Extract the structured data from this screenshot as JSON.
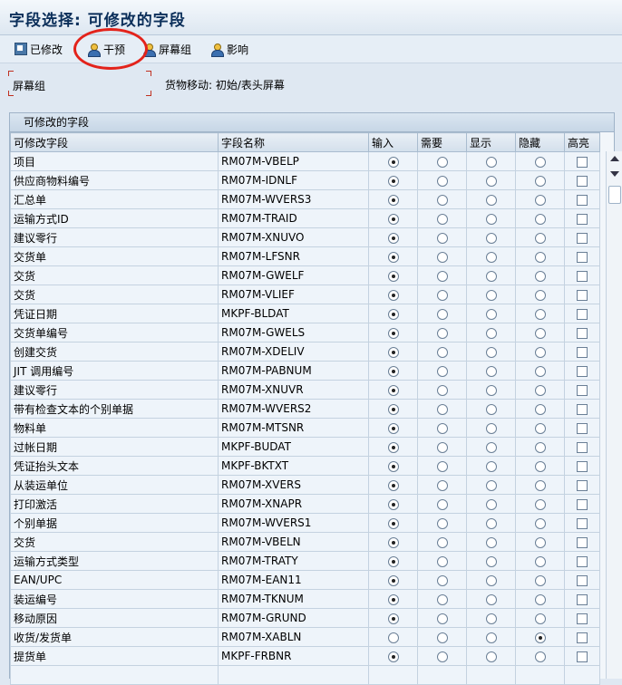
{
  "title": "字段选择: 可修改的字段",
  "toolbar": [
    {
      "label": "已修改",
      "icon": "edit-icon"
    },
    {
      "label": "干预",
      "icon": "person-icon"
    },
    {
      "label": "屏幕组",
      "icon": "person-icon"
    },
    {
      "label": "影响",
      "icon": "person-icon"
    }
  ],
  "screen_group": {
    "label": "屏幕组",
    "value": "货物移动: 初始/表头屏幕"
  },
  "panel_title": "可修改的字段",
  "columns": [
    "可修改字段",
    "字段名称",
    "输入",
    "需要",
    "显示",
    "隐藏",
    "高亮"
  ],
  "rows": [
    {
      "desc": "项目",
      "field": "RM07M-VBELP",
      "sel": "输入"
    },
    {
      "desc": "供应商物料编号",
      "field": "RM07M-IDNLF",
      "sel": "输入"
    },
    {
      "desc": "汇总单",
      "field": "RM07M-WVERS3",
      "sel": "输入"
    },
    {
      "desc": "运输方式ID",
      "field": "RM07M-TRAID",
      "sel": "输入"
    },
    {
      "desc": "建议零行",
      "field": "RM07M-XNUVO",
      "sel": "输入"
    },
    {
      "desc": "交货单",
      "field": "RM07M-LFSNR",
      "sel": "输入"
    },
    {
      "desc": "交货",
      "field": "RM07M-GWELF",
      "sel": "输入"
    },
    {
      "desc": "交货",
      "field": "RM07M-VLIEF",
      "sel": "输入"
    },
    {
      "desc": "凭证日期",
      "field": "MKPF-BLDAT",
      "sel": "输入"
    },
    {
      "desc": "交货单编号",
      "field": "RM07M-GWELS",
      "sel": "输入"
    },
    {
      "desc": "创建交货",
      "field": "RM07M-XDELIV",
      "sel": "输入"
    },
    {
      "desc": "JIT 调用编号",
      "field": "RM07M-PABNUM",
      "sel": "输入"
    },
    {
      "desc": "建议零行",
      "field": "RM07M-XNUVR",
      "sel": "输入"
    },
    {
      "desc": "带有检查文本的个别单据",
      "field": "RM07M-WVERS2",
      "sel": "输入"
    },
    {
      "desc": "物料单",
      "field": "RM07M-MTSNR",
      "sel": "输入"
    },
    {
      "desc": "过帐日期",
      "field": "MKPF-BUDAT",
      "sel": "输入"
    },
    {
      "desc": "凭证抬头文本",
      "field": "MKPF-BKTXT",
      "sel": "输入"
    },
    {
      "desc": "从装运单位",
      "field": "RM07M-XVERS",
      "sel": "输入"
    },
    {
      "desc": "打印激活",
      "field": "RM07M-XNAPR",
      "sel": "输入"
    },
    {
      "desc": "个别单据",
      "field": "RM07M-WVERS1",
      "sel": "输入"
    },
    {
      "desc": "交货",
      "field": "RM07M-VBELN",
      "sel": "输入"
    },
    {
      "desc": "运输方式类型",
      "field": "RM07M-TRATY",
      "sel": "输入"
    },
    {
      "desc": "EAN/UPC",
      "field": "RM07M-EAN11",
      "sel": "输入"
    },
    {
      "desc": "装运编号",
      "field": "RM07M-TKNUM",
      "sel": "输入"
    },
    {
      "desc": "移动原因",
      "field": "RM07M-GRUND",
      "sel": "输入"
    },
    {
      "desc": "收货/发货单",
      "field": "RM07M-XABLN",
      "sel": "隐藏"
    },
    {
      "desc": "提货单",
      "field": "MKPF-FRBNR",
      "sel": "输入"
    },
    {
      "desc": "",
      "field": "",
      "sel": ""
    }
  ],
  "colors": {
    "highlight_circle": "#e3231b",
    "title": "#0b2f5a"
  }
}
